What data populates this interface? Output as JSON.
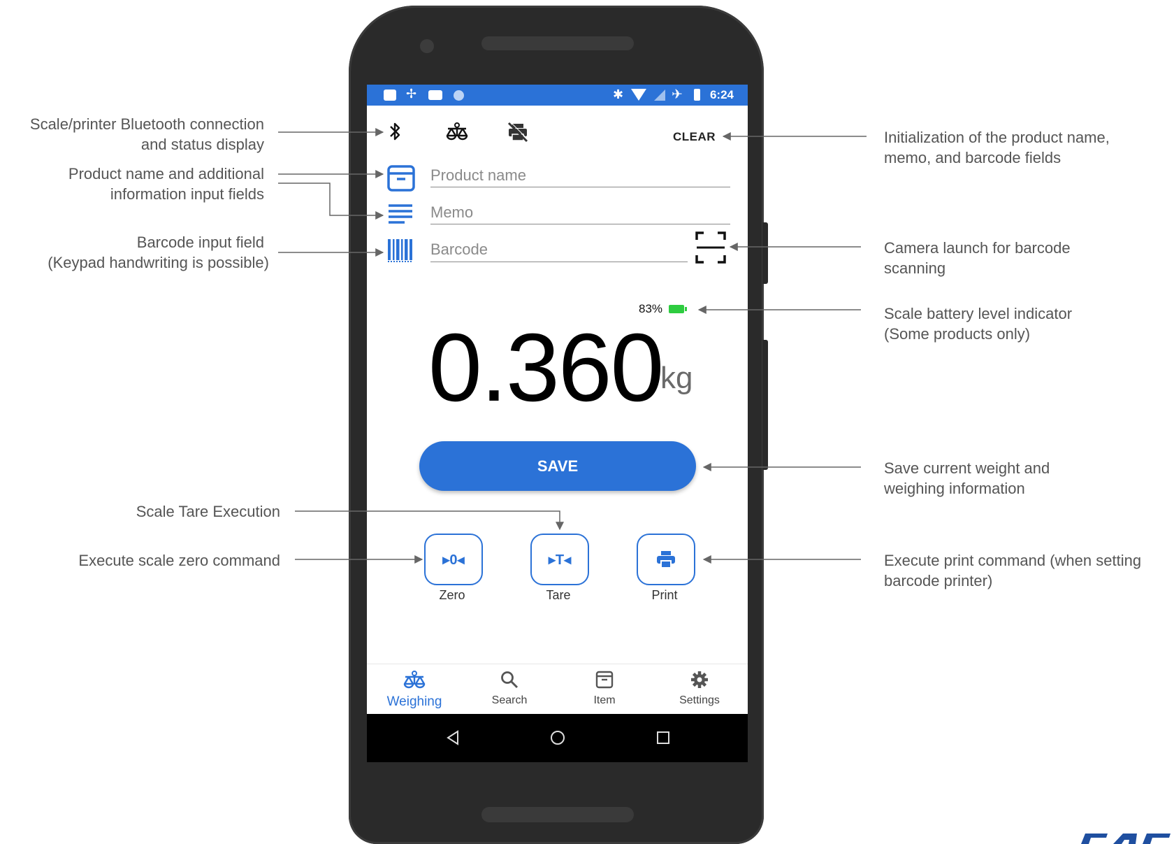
{
  "annotations": {
    "bluetooth": [
      "Scale/printer Bluetooth connection",
      "and status display"
    ],
    "product": [
      "Product name and additional",
      "information input fields"
    ],
    "barcode": [
      "Barcode input field",
      "(Keypad handwriting is possible)"
    ],
    "tare": [
      "Scale Tare Execution"
    ],
    "zero": [
      "Execute scale zero command"
    ],
    "clear": [
      "Initialization of the product name,",
      "memo, and barcode fields"
    ],
    "camera": [
      "Camera launch for barcode",
      "scanning"
    ],
    "battery": [
      "Scale battery level indicator",
      "(Some products only)"
    ],
    "save": [
      "Save current weight and",
      "weighing information"
    ],
    "print": [
      "Execute print command (when setting",
      "barcode printer)"
    ]
  },
  "status_bar": {
    "time": "6:24"
  },
  "toolbar": {
    "clear_label": "CLEAR"
  },
  "fields": {
    "product_placeholder": "Product name",
    "memo_placeholder": "Memo",
    "barcode_placeholder": "Barcode"
  },
  "scale": {
    "battery_percent": "83%",
    "weight": "0.360",
    "unit": "kg"
  },
  "actions": {
    "save_label": "SAVE",
    "zero_label": "Zero",
    "tare_label": "Tare",
    "print_label": "Print",
    "zero_glyph": "▸0◂",
    "tare_glyph": "▸T◂"
  },
  "bottom_nav": [
    {
      "label": "Weighing",
      "active": true
    },
    {
      "label": "Search"
    },
    {
      "label": "Item"
    },
    {
      "label": "Settings"
    }
  ],
  "colors": {
    "accent": "#2b72d7",
    "battery": "#2ecc40"
  }
}
